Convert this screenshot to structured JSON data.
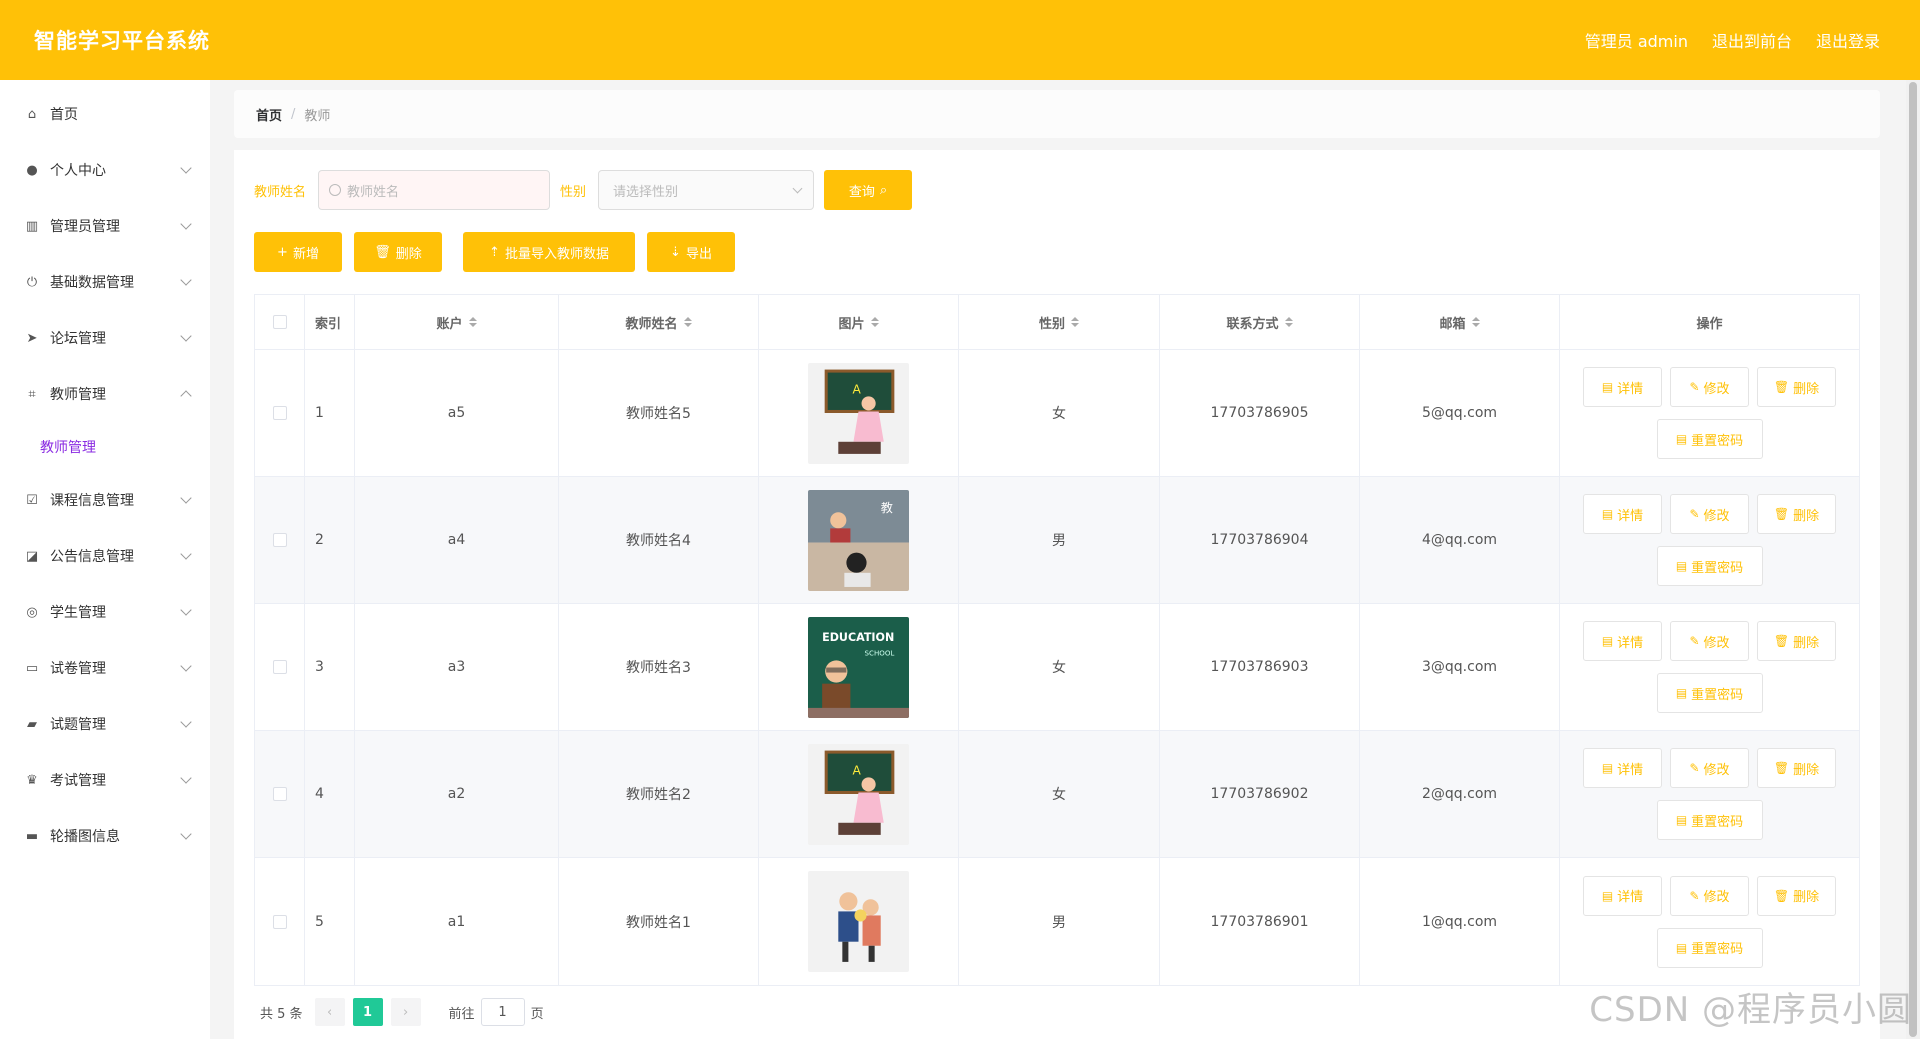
{
  "header": {
    "title": "智能学习平台系统",
    "admin_label": "管理员 admin",
    "front_link": "退出到前台",
    "logout_link": "退出登录",
    "bg_color": "#ffc107"
  },
  "sidebar": {
    "items": [
      {
        "label": "首页",
        "icon": "home-icon",
        "glyph": "⌂",
        "expand": ""
      },
      {
        "label": "个人中心",
        "icon": "user-icon",
        "glyph": "●",
        "expand": "down"
      },
      {
        "label": "管理员管理",
        "icon": "bars-icon",
        "glyph": "▥",
        "expand": "down"
      },
      {
        "label": "基础数据管理",
        "icon": "power-icon",
        "glyph": "⏻",
        "expand": "down"
      },
      {
        "label": "论坛管理",
        "icon": "send-icon",
        "glyph": "➤",
        "expand": "down"
      },
      {
        "label": "教师管理",
        "icon": "crop-icon",
        "glyph": "⌗",
        "expand": "up"
      },
      {
        "label": "课程信息管理",
        "icon": "check-square-icon",
        "glyph": "☑",
        "expand": "down"
      },
      {
        "label": "公告信息管理",
        "icon": "chart-icon",
        "glyph": "◪",
        "expand": "down"
      },
      {
        "label": "学生管理",
        "icon": "target-icon",
        "glyph": "◎",
        "expand": "down"
      },
      {
        "label": "试卷管理",
        "icon": "message-icon",
        "glyph": "▭",
        "expand": "down"
      },
      {
        "label": "试题管理",
        "icon": "briefcase-icon",
        "glyph": "▰",
        "expand": "down"
      },
      {
        "label": "考试管理",
        "icon": "trophy-icon",
        "glyph": "♛",
        "expand": "down"
      },
      {
        "label": "轮播图信息",
        "icon": "suitcase-icon",
        "glyph": "▬",
        "expand": "down"
      }
    ],
    "active_sub": "教师管理"
  },
  "breadcrumb": {
    "home": "首页",
    "sep": "/",
    "current": "教师"
  },
  "search": {
    "name_label": "教师姓名",
    "name_placeholder": "教师姓名",
    "sex_label": "性别",
    "sex_placeholder": "请选择性别",
    "query_button": "查询"
  },
  "actions": {
    "add": "新增",
    "delete": "删除",
    "import": "批量导入教师数据",
    "export": "导出"
  },
  "table": {
    "headers": {
      "index": "索引",
      "account": "账户",
      "name": "教师姓名",
      "image": "图片",
      "sex": "性别",
      "phone": "联系方式",
      "email": "邮箱",
      "ops": "操作"
    },
    "rows": [
      {
        "index": "1",
        "account": "a5",
        "name": "教师姓名5",
        "image": "teacher-chalkboard",
        "sex": "女",
        "phone": "17703786905",
        "email": "5@qq.com"
      },
      {
        "index": "2",
        "account": "a4",
        "name": "教师姓名4",
        "image": "classroom-scene",
        "sex": "男",
        "phone": "17703786904",
        "email": "4@qq.com"
      },
      {
        "index": "3",
        "account": "a3",
        "name": "教师姓名3",
        "image": "education-board",
        "sex": "女",
        "phone": "17703786903",
        "email": "3@qq.com"
      },
      {
        "index": "4",
        "account": "a2",
        "name": "教师姓名2",
        "image": "teacher-chalkboard",
        "sex": "女",
        "phone": "17703786902",
        "email": "2@qq.com"
      },
      {
        "index": "5",
        "account": "a1",
        "name": "教师姓名1",
        "image": "student-teacher-flowers",
        "sex": "男",
        "phone": "17703786901",
        "email": "1@qq.com"
      }
    ],
    "op_labels": {
      "detail": "详情",
      "edit": "修改",
      "delete": "删除",
      "reset": "重置密码"
    }
  },
  "pagination": {
    "total": "共 5 条",
    "current_page": "1",
    "goto_prefix": "前往",
    "goto_value": "1",
    "goto_suffix": "页"
  },
  "watermark": "CSDN @程序员小圆"
}
